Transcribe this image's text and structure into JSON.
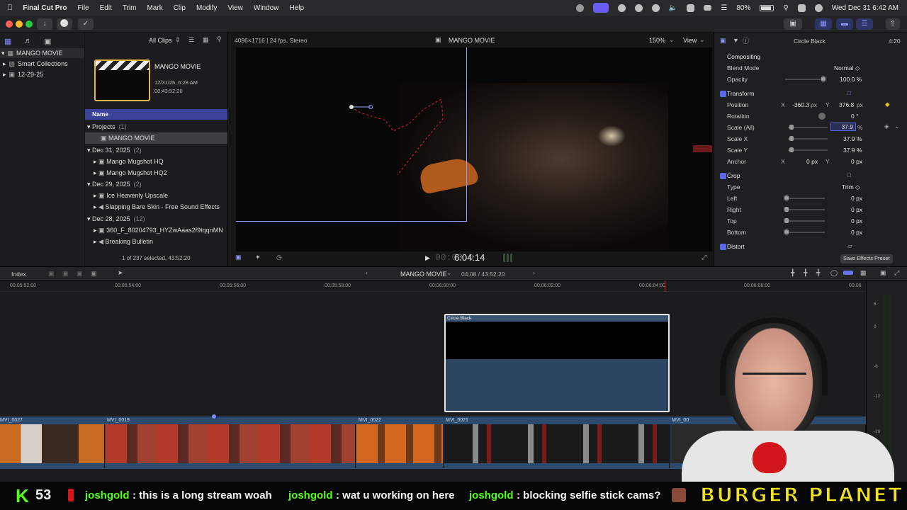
{
  "menubar": {
    "app_name": "Final Cut Pro",
    "items": [
      "File",
      "Edit",
      "Trim",
      "Mark",
      "Clip",
      "Modify",
      "View",
      "Window",
      "Help"
    ],
    "battery": "80%",
    "datetime": "Wed Dec 31  6:42 AM"
  },
  "library": {
    "name": "MANGO MOVIE",
    "items": [
      {
        "label": "Smart Collections"
      },
      {
        "label": "12-29-25"
      }
    ]
  },
  "browser": {
    "filter": "All Clips",
    "project_title": "MANGO MOVIE",
    "project_date": "12/31/25, 6:28 AM",
    "project_duration": "00:43:52:20",
    "column_header": "Name",
    "groups": [
      {
        "label": "Projects",
        "count": "(1)",
        "items": [
          "MANGO MOVIE"
        ]
      },
      {
        "label": "Dec 31, 2025",
        "count": "(2)",
        "items": [
          "Mango Mugshot HQ",
          "Mango Mugshot HQ2"
        ]
      },
      {
        "label": "Dec 29, 2025",
        "count": "(2)",
        "items": [
          "Ice Heavenly Upscale",
          "Slapping Bare Skin - Free Sound Effects"
        ]
      },
      {
        "label": "Dec 28, 2025",
        "count": "(12)",
        "items": [
          "360_F_80204793_HYZwAaas2f9tqqnMN",
          "Breaking Bulletin"
        ]
      }
    ],
    "selection_status": "1 of 237 selected, 43:52:20"
  },
  "viewer": {
    "format": "4096×1716 | 24 fps, Stereo",
    "title": "MANGO MOVIE",
    "zoom": "150%",
    "view_menu": "View",
    "timecode": "6:04:14",
    "timecode_prefix": "00:00:0"
  },
  "inspector": {
    "clip_name": "Circle Black",
    "duration": "4:20",
    "compositing": {
      "title": "Compositing",
      "blend_label": "Blend Mode",
      "blend_value": "Normal ◇",
      "opacity_label": "Opacity",
      "opacity_value": "100.0 %"
    },
    "transform": {
      "title": "Transform",
      "position_label": "Position",
      "pos_x_label": "X",
      "pos_x": "-360.3",
      "pos_unit": "px",
      "pos_y_label": "Y",
      "pos_y": "376.8",
      "pos_y_unit": "px",
      "rotation_label": "Rotation",
      "rotation": "0 °",
      "scale_all_label": "Scale (All)",
      "scale_all": "37.9",
      "scale_x_label": "Scale X",
      "scale_x": "37.9 %",
      "scale_y_label": "Scale Y",
      "scale_y": "37.9 %",
      "anchor_label": "Anchor",
      "anchor_x_label": "X",
      "anchor_x": "0 px",
      "anchor_y_label": "Y",
      "anchor_y": "0 px",
      "pct": "%"
    },
    "crop": {
      "title": "Crop",
      "type_label": "Type",
      "type_value": "Trim ◇",
      "left_label": "Left",
      "right_label": "Right",
      "top_label": "Top",
      "bottom_label": "Bottom",
      "value": "0 px"
    },
    "distort_title": "Distort",
    "save_preset": "Save Effects Preset"
  },
  "timeline": {
    "index_label": "Index",
    "project_name": "MANGO MOVIE",
    "position": "04:08 / 43:52:20",
    "ruler": [
      "00:05:52:00",
      "00:05:54:00",
      "00:05:56:00",
      "00:05:58:00",
      "00:06:00:00",
      "00:06:02:00",
      "00:06:04:00",
      "00:06:06:00",
      "00:06"
    ],
    "title_clip": "Circle Black",
    "clips": [
      "MVI_0027",
      "MVI_0019",
      "MVI_0022",
      "MVI_0021",
      "MVI_00"
    ],
    "meter_labels": [
      "6",
      "0",
      "-6",
      "-12",
      "-20"
    ]
  },
  "stream_overlay": {
    "count_label": "K",
    "count": "53",
    "chat": [
      {
        "user": "joshgold",
        "msg": ": this is a long stream woah"
      },
      {
        "user": "joshgold",
        "msg": ": wat u working on here"
      },
      {
        "user": "joshgold",
        "msg": ": blocking selfie stick cams?"
      }
    ],
    "banner": "BURGER PLANET"
  },
  "colors": {
    "accent": "#5a67e8",
    "kick_green": "#53fc18",
    "banner_yellow": "#f2e21c"
  }
}
